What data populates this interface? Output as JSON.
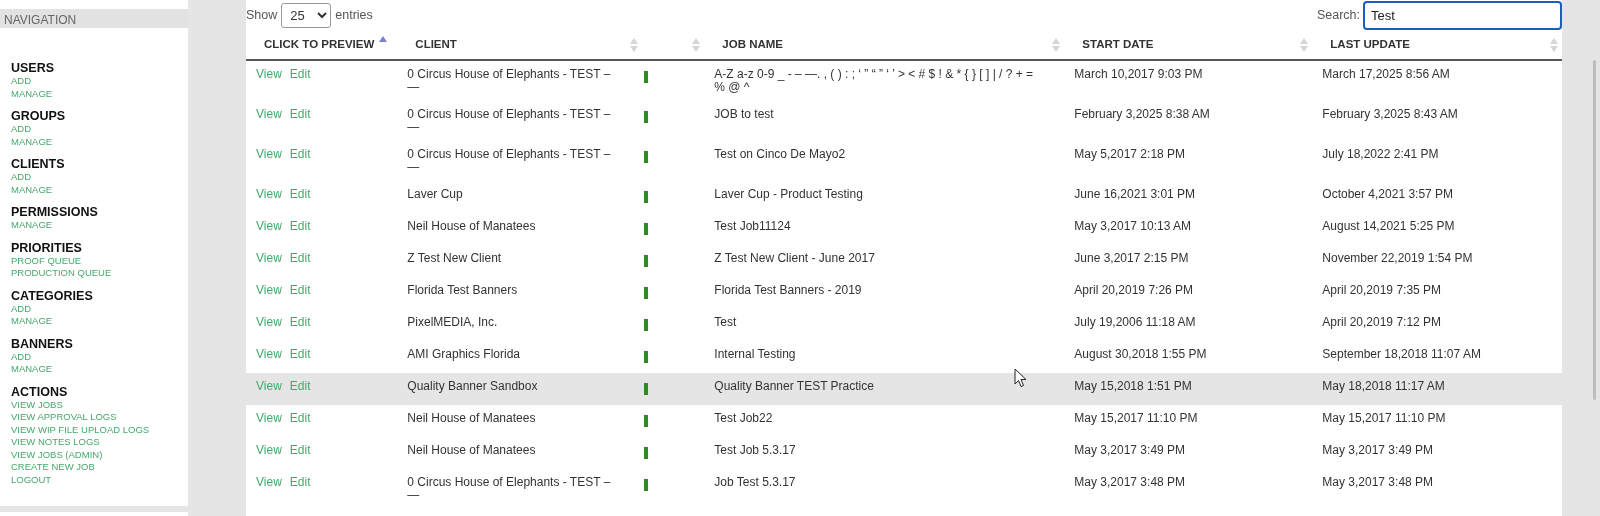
{
  "sidebar": {
    "title": "NAVIGATION",
    "groups": [
      {
        "heading": "USERS",
        "links": [
          "ADD",
          "MANAGE"
        ]
      },
      {
        "heading": "GROUPS",
        "links": [
          "ADD",
          "MANAGE"
        ]
      },
      {
        "heading": "CLIENTS",
        "links": [
          "ADD",
          "MANAGE"
        ]
      },
      {
        "heading": "PERMISSIONS",
        "links": [
          "MANAGE"
        ]
      },
      {
        "heading": "PRIORITIES",
        "links": [
          "PROOF QUEUE",
          "PRODUCTION QUEUE"
        ]
      },
      {
        "heading": "CATEGORIES",
        "links": [
          "ADD",
          "MANAGE"
        ]
      },
      {
        "heading": "BANNERS",
        "links": [
          "ADD",
          "MANAGE"
        ]
      },
      {
        "heading": "ACTIONS",
        "links": [
          "VIEW JOBS",
          "VIEW APPROVAL LOGS",
          "VIEW WIP FILE UPLOAD LOGS",
          "VIEW NOTES LOGS",
          "VIEW JOBS (ADMIN)",
          "CREATE NEW JOB",
          "LOGOUT"
        ]
      }
    ]
  },
  "length_menu": {
    "label_before": "Show",
    "value": "25",
    "label_after": "entries"
  },
  "search": {
    "label": "Search:",
    "value": "Test"
  },
  "table": {
    "columns": [
      {
        "label": "CLICK TO PREVIEW",
        "sorted": true
      },
      {
        "label": "CLIENT",
        "sorted": false
      },
      {
        "sorted": false
      },
      {
        "label": "JOB NAME",
        "sorted": false
      },
      {
        "label": "START DATE",
        "sorted": false
      },
      {
        "label": "LAST UPDATE",
        "sorted": false
      }
    ],
    "rows": [
      {
        "view": "View",
        "edit": "Edit",
        "client": "0 Circus House of Elephants - TEST – —",
        "color": "#2e8b1e",
        "job": "A-Z a-z 0-9 _ - – —. , ( ) : ; ‘ ” “ ” ‘ ’ > < # $ ! & * { } [ ] | / ? + = % @ ^",
        "start": "March 10,2017 9:03 PM",
        "updated": "March 17,2025 8:56 AM",
        "selected": false
      },
      {
        "view": "View",
        "edit": "Edit",
        "client": "0 Circus House of Elephants - TEST – —",
        "color": "#2e8b1e",
        "job": "JOB to test",
        "start": "February 3,2025 8:38 AM",
        "updated": "February 3,2025 8:43 AM",
        "selected": false
      },
      {
        "view": "View",
        "edit": "Edit",
        "client": "0 Circus House of Elephants - TEST – —",
        "color": "#2e8b1e",
        "job": "Test on Cinco De Mayo2",
        "start": "May 5,2017 2:18 PM",
        "updated": "July 18,2022 2:41 PM",
        "selected": false
      },
      {
        "view": "View",
        "edit": "Edit",
        "client": "Laver Cup",
        "color": "#2e8b1e",
        "job": "Laver Cup - Product Testing",
        "start": "June 16,2021 3:01 PM",
        "updated": "October 4,2021 3:57 PM",
        "selected": false
      },
      {
        "view": "View",
        "edit": "Edit",
        "client": "Neil House of Manatees",
        "color": "#2e8b1e",
        "job": "Test Job11124",
        "start": "May 3,2017 10:13 AM",
        "updated": "August 14,2021 5:25 PM",
        "selected": false
      },
      {
        "view": "View",
        "edit": "Edit",
        "client": "Z Test New Client",
        "color": "#2e8b1e",
        "job": "Z Test New Client - June 2017",
        "start": "June 3,2017 2:15 PM",
        "updated": "November 22,2019 1:54 PM",
        "selected": false
      },
      {
        "view": "View",
        "edit": "Edit",
        "client": "Florida Test Banners",
        "color": "#2e8b1e",
        "job": "Florida Test Banners - 2019",
        "start": "April 20,2019 7:26 PM",
        "updated": "April 20,2019 7:35 PM",
        "selected": false
      },
      {
        "view": "View",
        "edit": "Edit",
        "client": "PixelMEDIA, Inc.",
        "color": "#2e8b1e",
        "job": "Test",
        "start": "July 19,2006 11:18 AM",
        "updated": "April 20,2019 7:12 PM",
        "selected": false
      },
      {
        "view": "View",
        "edit": "Edit",
        "client": "AMI Graphics Florida",
        "color": "#2e8b1e",
        "job": "Internal Testing",
        "start": "August 30,2018 1:55 PM",
        "updated": "September 18,2018 11:07 AM",
        "selected": false
      },
      {
        "view": "View",
        "edit": "Edit",
        "client": "Quality Banner Sandbox",
        "color": "#2e8b1e",
        "job": "Quality Banner TEST Practice",
        "start": "May 15,2018 1:51 PM",
        "updated": "May 18,2018 11:17 AM",
        "selected": true
      },
      {
        "view": "View",
        "edit": "Edit",
        "client": "Neil House of Manatees",
        "color": "#2e8b1e",
        "job": "Test Job22",
        "start": "May 15,2017 11:10 PM",
        "updated": "May 15,2017 11:10 PM",
        "selected": false
      },
      {
        "view": "View",
        "edit": "Edit",
        "client": "Neil House of Manatees",
        "color": "#2e8b1e",
        "job": "Test Job 5.3.17",
        "start": "May 3,2017 3:49 PM",
        "updated": "May 3,2017 3:49 PM",
        "selected": false
      },
      {
        "view": "View",
        "edit": "Edit",
        "client": "0 Circus House of Elephants - TEST – —",
        "color": "#2e8b1e",
        "job": "Job Test 5.3.17",
        "start": "May 3,2017 3:48 PM",
        "updated": "May 3,2017 3:48 PM",
        "selected": false
      }
    ]
  }
}
